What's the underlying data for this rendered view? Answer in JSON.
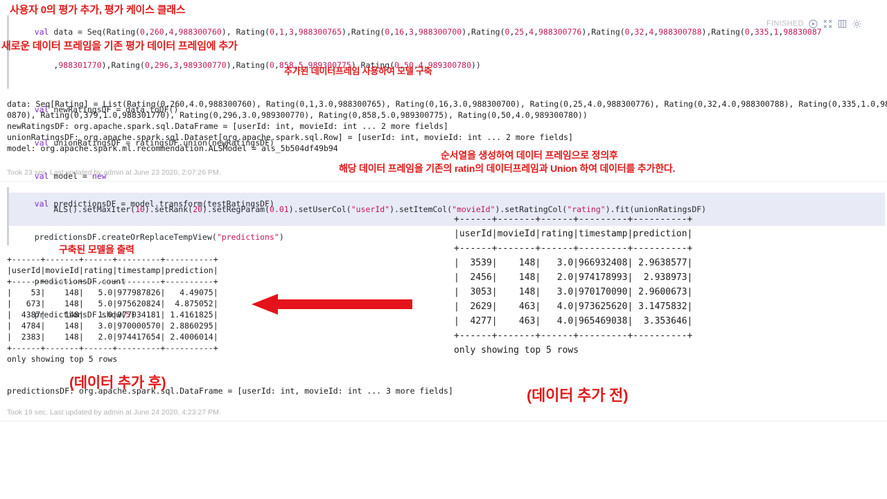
{
  "notebook": {
    "run_status": "FINISHED",
    "toolbar_icons": [
      "play-icon",
      "collapse-icon",
      "book-icon",
      "gear-icon"
    ],
    "accent_annotation_color": "#e01b1b",
    "selected_line_highlight": "#e8eaf6"
  },
  "paragraph1": {
    "code_lines": [
      "val data = Seq(Rating(0,260,4,988300760), Rating(0,1,3,988300765),Rating(0,16,3,988300700),Rating(0,25,4,988300776),Rating(0,32,4,988300788),Rating(0,335,1,98830087",
      "    ,988301770),Rating(0,296,3,989300770),Rating(0,858,5,989300775),Rating(0,50,4,989300780))",
      "",
      "val newRatingsDF = data.toDF()",
      "val unionRatingsDF = ratingsDF.union(newRatingsDF)",
      "val model = new",
      "    ALS().setMaxIter(10).setRank(20).setRegParam(0.01).setUserCol(\"userId\").setItemCol(\"movieId\").setRatingCol(\"rating\").fit(unionRatingsDF)"
    ],
    "output_lines": [
      "data: Seq[Rating] = List(Rating(0,260,4.0,988300760), Rating(0,1,3.0,988300765), Rating(0,16,3.0,988300700), Rating(0,25,4.0,988300776), Rating(0,32,4.0,988300788), Rating(0,335,1.0,98830",
      "0870), Rating(0,379,1.0,988301770), Rating(0,296,3.0,989300770), Rating(0,858,5.0,989300775), Rating(0,50,4.0,989300780))",
      "newRatingsDF: org.apache.spark.sql.DataFrame = [userId: int, movieId: int ... 2 more fields]",
      "unionRatingsDF: org.apache.spark.sql.Dataset[org.apache.spark.sql.Row] = [userId: int, movieId: int ... 2 more fields]",
      "model: org.apache.spark.ml.recommendation.ALSModel = als_5b504df49b94"
    ],
    "status": "Took 23 sec. Last updated by admin at June 23 2020, 2:07:26 PM."
  },
  "paragraph2": {
    "code_lines": [
      "val predictionsDF = model.transform(testRatingsDF)",
      "predictionsDF.createOrReplaceTempView(\"predictions\")",
      "",
      "predictionsDF.count",
      "predictionsDF.show(5)"
    ],
    "output_table_after": {
      "rule": "+------+-------+------+---------+----------+",
      "header": "|userId|movieId|rating|timestamp|prediction|",
      "rows": [
        "|    53|    148|   5.0|977987826|   4.49075|",
        "|   673|    148|   5.0|975620824|  4.875052|",
        "|  4387|    148|   1.0|977034181| 1.4161825|",
        "|  4784|    148|   3.0|970000570| 2.8860295|",
        "|  2383|    148|   2.0|974417654| 2.4006014|"
      ],
      "footer": "only showing top 5 rows"
    },
    "output_schema_line": "predictionsDF: org.apache.spark.sql.DataFrame = [userId: int, movieId: int ... 3 more fields]",
    "status": "Took 19 sec. Last updated by admin at June 24 2020, 4:23:27 PM."
  },
  "reference_table_before": {
    "rule": "+------+-------+------+---------+----------+",
    "header": "|userId|movieId|rating|timestamp|prediction|",
    "rows": [
      "|  3539|    148|   3.0|966932408| 2.9638577|",
      "|  2456|    148|   2.0|974178993|  2.938973|",
      "|  3053|    148|   3.0|970170090| 2.9600673|",
      "|  2629|    463|   4.0|973625620| 3.1475832|",
      "|  4277|    463|   4.0|965469038|  3.353646|"
    ],
    "footer": "only showing top 5 rows"
  },
  "annotations": {
    "title": "사용자 0의 평가 추가, 평가 케이스 클래스",
    "add_new_df": "새로운 데이터 프레임을 기존 평가 데이터 프레임에 추가",
    "build_model": "추가된 데이터프레임 사용하여 모델 구축",
    "union_desc_line1": "순서열을 생성하여 데이터 프레임으로 정의후",
    "union_desc_line2": "해당 데이터 프레임을 기존의 ratin의 데이터프레임과 Union 하여 데이터를 추가한다.",
    "print_model": "구축된 모델을 출력",
    "after_label": "(데이터 추가 후)",
    "before_label": "(데이터 추가 전)",
    "arrow": "left-arrow"
  }
}
